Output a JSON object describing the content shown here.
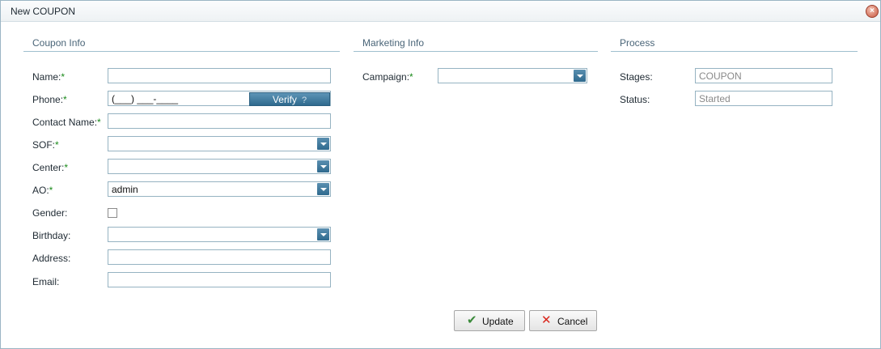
{
  "window": {
    "title": "New COUPON"
  },
  "sections": {
    "coupon_info": "Coupon Info",
    "marketing_info": "Marketing Info",
    "process": "Process"
  },
  "coupon": {
    "name_label": "Name:",
    "name_value": "",
    "phone_label": "Phone:",
    "phone_value": "(___) ___-____",
    "verify_label": "Verify",
    "verify_help": "?",
    "contact_label": "Contact Name:",
    "contact_value": "",
    "sof_label": "SOF:",
    "sof_value": "",
    "center_label": "Center:",
    "center_value": "",
    "ao_label": "AO:",
    "ao_value": "admin",
    "gender_label": "Gender:",
    "gender_checked": false,
    "birthday_label": "Birthday:",
    "birthday_value": "",
    "address_label": "Address:",
    "address_value": "",
    "email_label": "Email:",
    "email_value": ""
  },
  "marketing": {
    "campaign_label": "Campaign:",
    "campaign_value": ""
  },
  "process": {
    "stages_label": "Stages:",
    "stages_value": "COUPON",
    "status_label": "Status:",
    "status_value": "Started"
  },
  "required_mark": "*",
  "buttons": {
    "update": "Update",
    "cancel": "Cancel"
  },
  "colors": {
    "accent": "#2f6a8e",
    "required": "#1a8a1a",
    "cancel_icon": "#d9261c",
    "update_icon": "#3a8a3a"
  }
}
